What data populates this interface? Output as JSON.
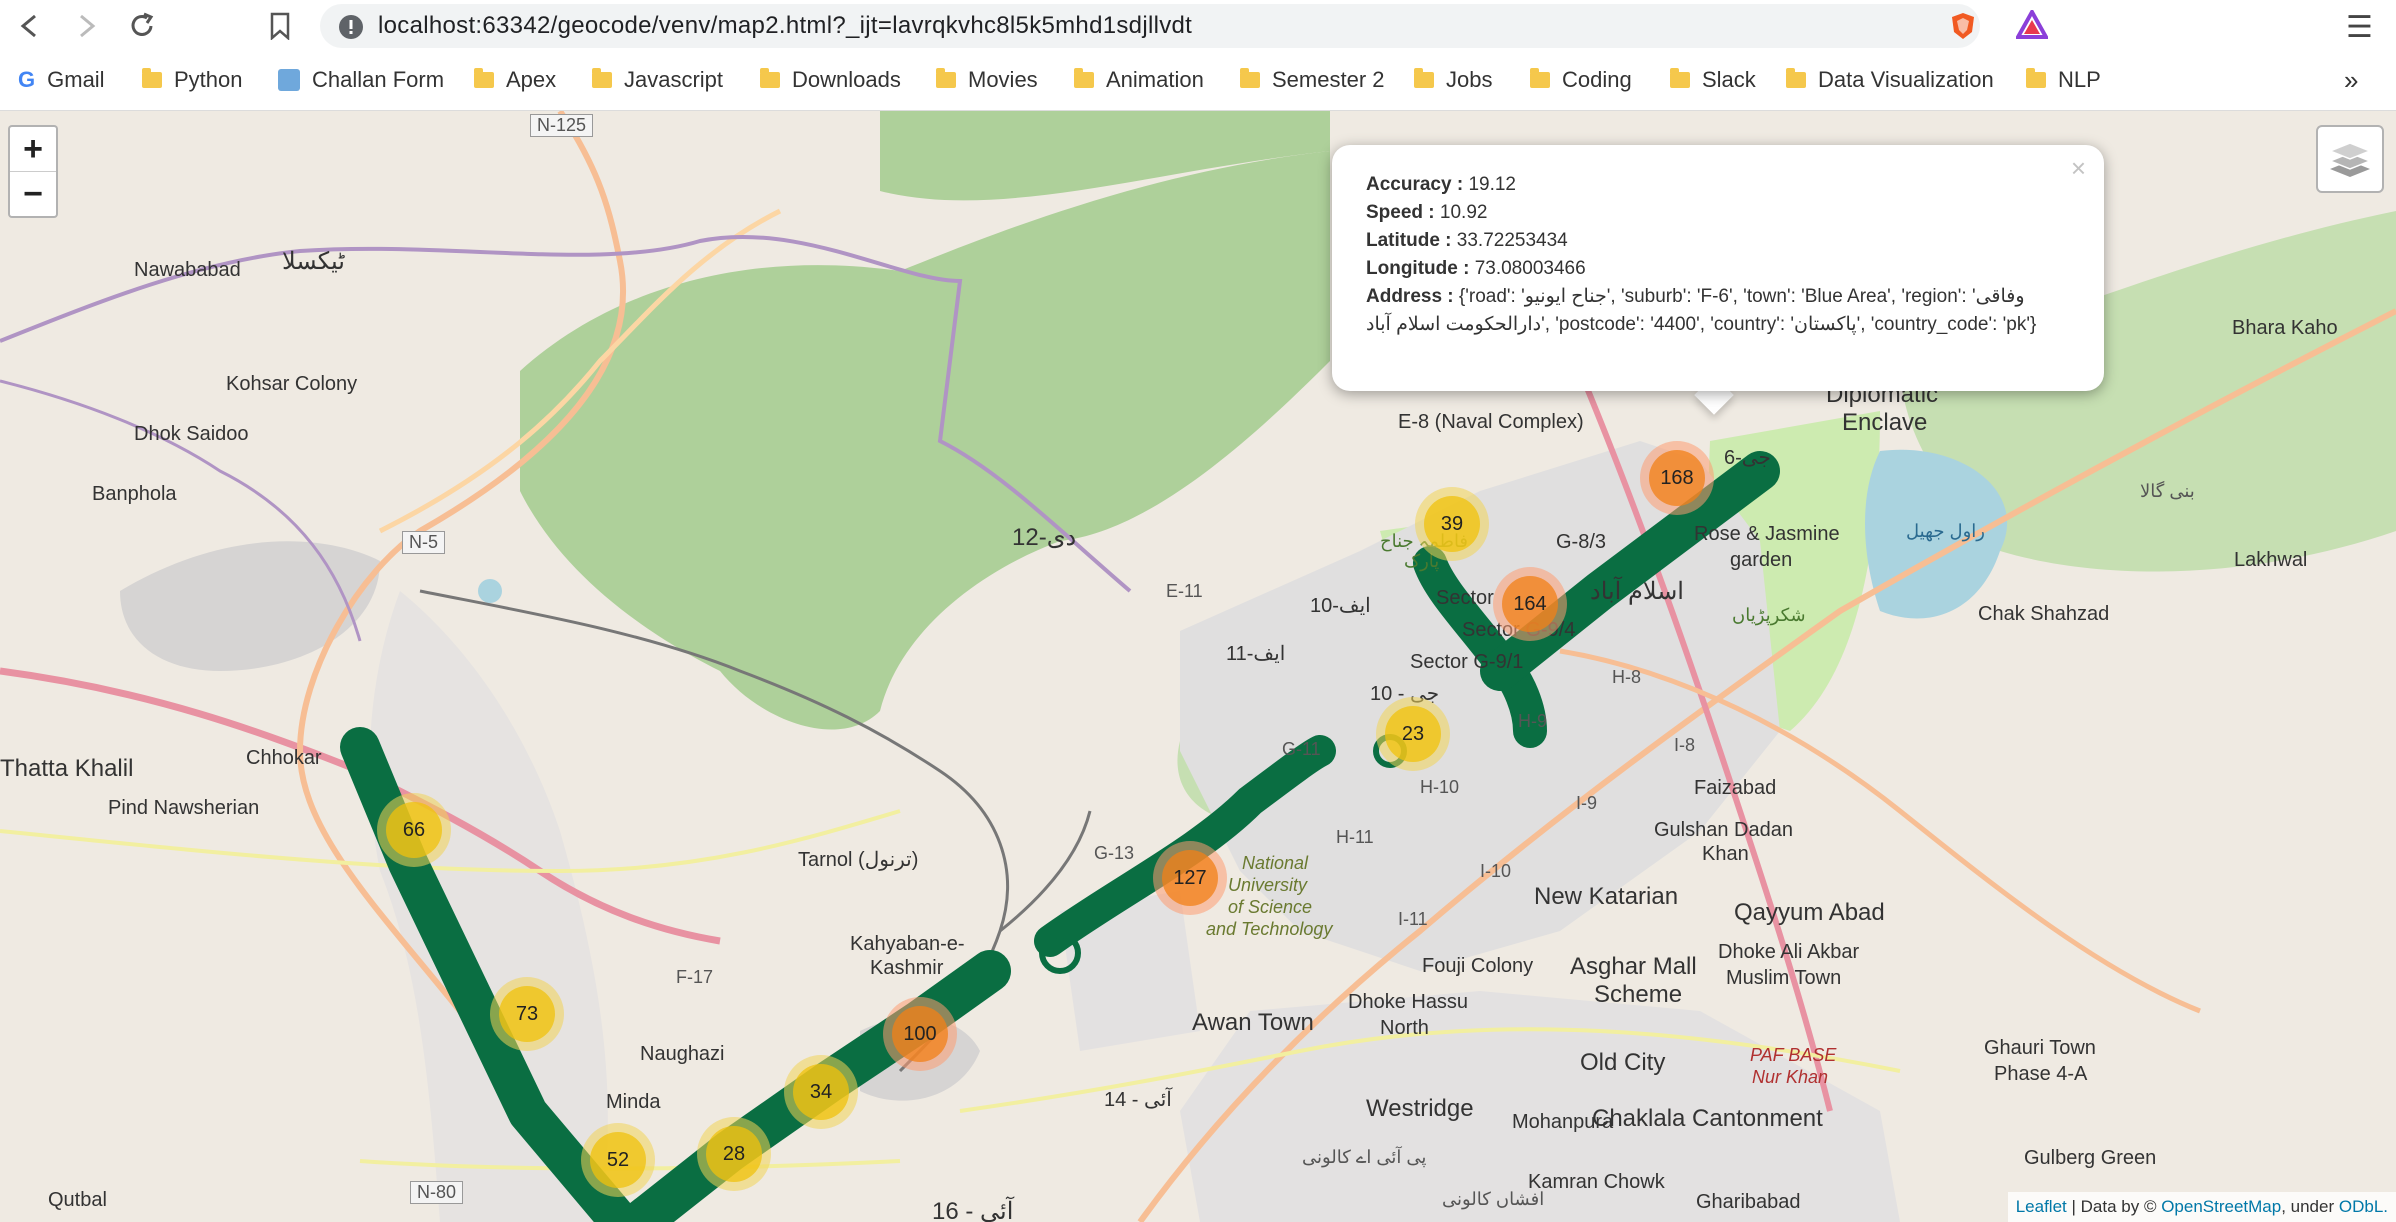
{
  "browser": {
    "url": "localhost:63342/geocode/venv/map2.html?_ijt=lavrqkvhc8l5k5mhd1sdjllvdt",
    "bookmarks": [
      {
        "label": "Gmail",
        "icon": "gmail-icon"
      },
      {
        "label": "Python",
        "icon": "folder-icon"
      },
      {
        "label": "Challan Form",
        "icon": "page-icon"
      },
      {
        "label": "Apex",
        "icon": "folder-icon"
      },
      {
        "label": "Javascript",
        "icon": "folder-icon"
      },
      {
        "label": "Downloads",
        "icon": "folder-icon"
      },
      {
        "label": "Movies",
        "icon": "folder-icon"
      },
      {
        "label": "Animation",
        "icon": "folder-icon"
      },
      {
        "label": "Semester 2",
        "icon": "folder-icon"
      },
      {
        "label": "Jobs",
        "icon": "folder-icon"
      },
      {
        "label": "Coding",
        "icon": "folder-icon"
      },
      {
        "label": "Slack",
        "icon": "folder-icon"
      },
      {
        "label": "Data Visualization",
        "icon": "folder-icon"
      },
      {
        "label": "NLP",
        "icon": "folder-icon"
      }
    ],
    "overflow": "»"
  },
  "map": {
    "zoom_in": "+",
    "zoom_out": "−",
    "clusters": [
      {
        "count": "39",
        "color": "yellow"
      },
      {
        "count": "168",
        "color": "orange"
      },
      {
        "count": "164",
        "color": "orange"
      },
      {
        "count": "23",
        "color": "yellow"
      },
      {
        "count": "127",
        "color": "orange"
      },
      {
        "count": "100",
        "color": "orange"
      },
      {
        "count": "34",
        "color": "yellow"
      },
      {
        "count": "28",
        "color": "yellow"
      },
      {
        "count": "52",
        "color": "yellow"
      },
      {
        "count": "73",
        "color": "yellow"
      },
      {
        "count": "66",
        "color": "yellow"
      }
    ],
    "labels": {
      "nawababad": "Nawababad",
      "taxila_ur": "ٹیکسلا",
      "kohsar": "Kohsar Colony",
      "dhok_saidoo": "Dhok Saidoo",
      "banphola": "Banphola",
      "thatta": "Thatta Khalil",
      "chhokar": "Chhokar",
      "pind": "Pind Nawsherian",
      "tarnol": "Tarnol (ترنول)",
      "kahyaban": "Kahyaban-e-",
      "kashmir": "Kashmir",
      "naughazi": "Naughazi",
      "minda": "Minda",
      "qutbal": "Qutbal",
      "awan": "Awan Town",
      "westridge": "Westridge",
      "chaklala": "Chaklala Cantonment",
      "old_city": "Old City",
      "asghar": "Asghar Mall",
      "scheme": "Scheme",
      "dhoke_hassu": "Dhoke Hassu",
      "north": "North",
      "fouji": "Fouji Colony",
      "new_katarian": "New Katarian",
      "gulshan": "Gulshan Dadan",
      "khan": "Khan",
      "qayyum": "Qayyum Abad",
      "dhoke_ali": "Dhoke Ali Akbar",
      "muslim": "Muslim Town",
      "faizabad": "Faizabad",
      "ghauri": "Ghauri Town",
      "phase": "Phase 4-A",
      "gulberg": "Gulberg Green",
      "mohanpura": "Mohanpura",
      "kamran": "Kamran Chowk",
      "ghari": "Gharibabad",
      "pafbase": "PAF BASE",
      "nurkhan": "Nur Khan",
      "rose": "Rose & Jasmine",
      "garden": "garden",
      "diplomatic": "Diplomatic",
      "enclave": "Enclave",
      "bhara": "Bhara Kaho",
      "lakhwal": "Lakhwal",
      "chak": "Chak Shahzad",
      "e8": "E-8 (Naval Complex)",
      "e11": "E-11",
      "g13": "G-13",
      "g11": "G-11",
      "h10": "H-10",
      "h11": "H-11",
      "h9": "H-9",
      "h8": "H-8",
      "i8": "I-8",
      "i9": "I-9",
      "i10": "I-10",
      "i11": "I-11",
      "f17": "F-17",
      "g83": "G-8/3",
      "g91": "Sector G-9/1",
      "sector": "Sector",
      "sector94": "Sector G-9/4",
      "isb_ur": "اسلام آباد",
      "nust1": "National",
      "nust2": "University",
      "nust3": "of Science",
      "nust4": "and Technology",
      "d12": "دی-12",
      "f10": "ایف-10",
      "f11": "ایف-11",
      "g10": "جی - 10",
      "g6": "جی-6",
      "i14": "آئی - 14",
      "i16": "آئی - 16",
      "n125": "N-125",
      "n5": "N-5",
      "n80": "N-80",
      "shakarparian": "شکرپڑیاں",
      "rawal": "راول جھیل",
      "bani_gala": "بنی گالا",
      "pia": "پی آئی اے کالونی",
      "afshan": "افشاں کالونی",
      "fatima": "فاطمہ جناح",
      "park": "پارک"
    },
    "popup": {
      "close": "×",
      "accuracy_label": "Accuracy :",
      "accuracy": "19.12",
      "speed_label": "Speed :",
      "speed": "10.92",
      "lat_label": "Latitude :",
      "lat": "33.72253434",
      "lon_label": "Longitude :",
      "lon": "73.08003466",
      "address_label": "Address :",
      "address": "{'road': 'جناح ایونیو', 'suburb': 'F-6', 'town': 'Blue Area', 'region': 'وفاقی دارالحکومت اسلام آباد', 'postcode': '4400', 'country': 'پاکستان', 'country_code': 'pk'}"
    },
    "attribution": {
      "leaflet": "Leaflet",
      "sep": " | Data by © ",
      "osm": "OpenStreetMap",
      "under": ", under ",
      "odbl": "ODbL."
    },
    "colors": {
      "track": "#0a6e42",
      "forest": "#aed09a",
      "urban": "#dedede",
      "water": "#aad3df",
      "motorway": "#e892a2",
      "primary": "#fcd6a4"
    }
  }
}
